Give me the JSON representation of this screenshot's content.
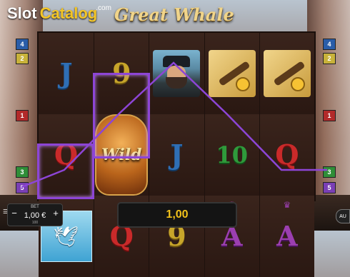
{
  "logo": {
    "slot": "Slot",
    "catalog": "Catalog",
    "com": ".com"
  },
  "game_title": "Great Whale",
  "symbols": {
    "j": "J",
    "nine": "9",
    "q": "Q",
    "ten": "10",
    "a": "A",
    "wild": "Wild"
  },
  "markers": {
    "left": [
      "4",
      "2",
      "1",
      "3",
      "5"
    ],
    "right": [
      "4",
      "2",
      "1",
      "3",
      "5"
    ]
  },
  "colors": {
    "marker_4": "#2a5da8",
    "marker_2": "#c8b23a",
    "marker_1": "#b22a2a",
    "marker_3": "#2f8e38",
    "marker_5": "#7a3fb5",
    "payline": "#8d45d6"
  },
  "bet": {
    "label": "BET",
    "value": "1,00 €",
    "sub": "100"
  },
  "win": {
    "value": "1,00"
  },
  "auto_label": "AU",
  "icons": {
    "bet_minus": "minus-icon",
    "bet_plus": "plus-icon",
    "menu": "menu-icon",
    "gull": "seagull-icon",
    "crown": "crown-icon"
  }
}
